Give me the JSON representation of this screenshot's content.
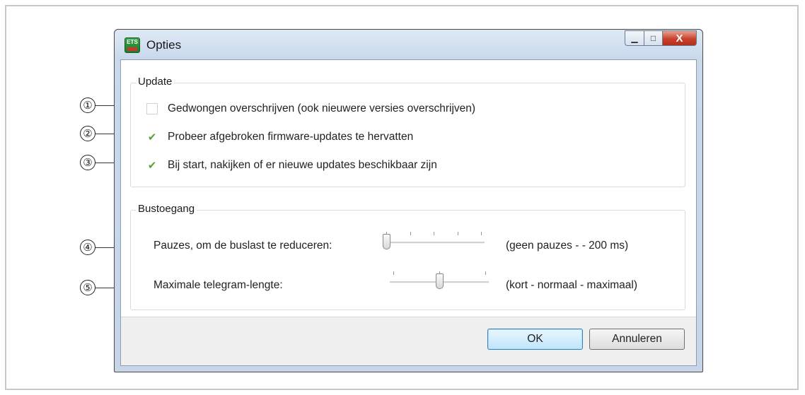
{
  "window": {
    "title": "Opties",
    "icon_text": "ETS",
    "close_glyph": "X",
    "minimize_glyph": "▁",
    "maximize_glyph": "□"
  },
  "update_group": {
    "title": "Update",
    "options": [
      {
        "label": "Gedwongen overschrijven (ook nieuwere versies overschrijven)",
        "checked": false
      },
      {
        "label": "Probeer afgebroken firmware-updates te hervatten",
        "checked": true
      },
      {
        "label": "Bij start, nakijken of er nieuwe updates beschikbaar zijn",
        "checked": true
      }
    ]
  },
  "bus_group": {
    "title": "Bustoegang",
    "pauses": {
      "label": "Pauzes, om de buslast te reduceren:",
      "range_text": "(geen pauzes - - 200 ms)",
      "value": 0
    },
    "telegram": {
      "label": "Maximale telegram-lengte:",
      "range_text": "(kort - normaal - maximaal)",
      "value": 1
    }
  },
  "buttons": {
    "ok": "OK",
    "cancel": "Annuleren"
  },
  "callouts": [
    "①",
    "②",
    "③",
    "④",
    "⑤"
  ],
  "icons": {
    "check": "✔"
  }
}
